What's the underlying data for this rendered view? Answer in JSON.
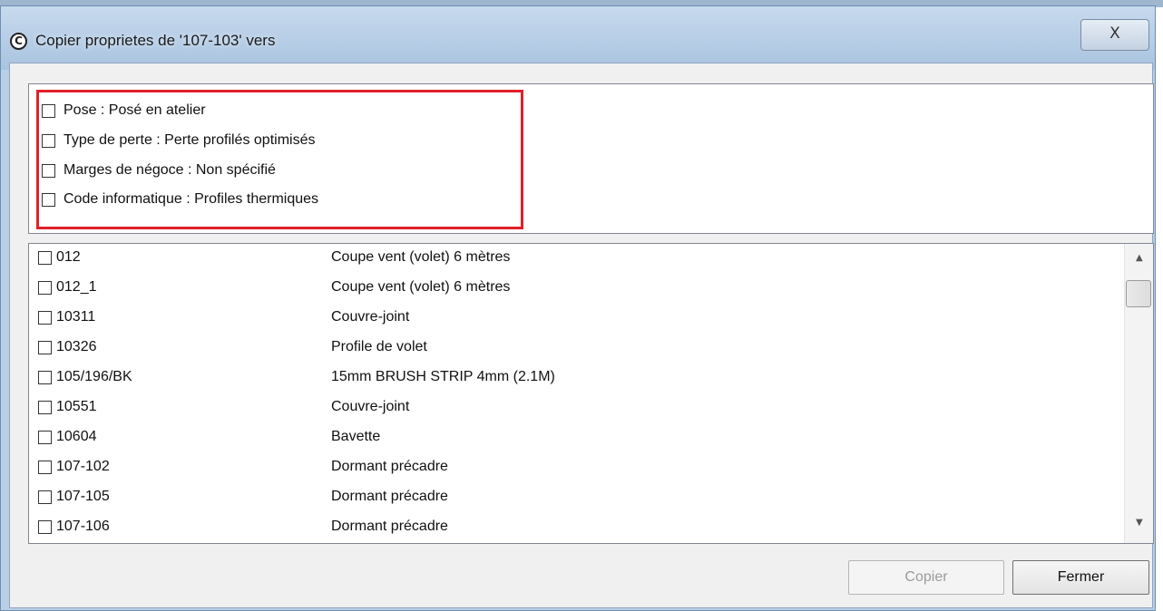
{
  "window": {
    "title": "Copier proprietes de '107-103' vers",
    "icon": "c-logo-icon",
    "close_glyph": "X"
  },
  "properties": [
    {
      "label": "Pose : Posé en atelier",
      "checked": false
    },
    {
      "label": "Type de perte : Perte profilés optimisés",
      "checked": false
    },
    {
      "label": "Marges de négoce : Non spécifié",
      "checked": false
    },
    {
      "label": "Code informatique : Profiles thermiques",
      "checked": false
    }
  ],
  "items": [
    {
      "code": "012",
      "description": "Coupe vent (volet) 6 mètres"
    },
    {
      "code": "012_1",
      "description": "Coupe vent (volet) 6 mètres"
    },
    {
      "code": "10311",
      "description": "Couvre-joint"
    },
    {
      "code": "10326",
      "description": "Profile de volet"
    },
    {
      "code": "105/196/BK",
      "description": "15mm BRUSH STRIP 4mm (2.1M)"
    },
    {
      "code": "10551",
      "description": "Couvre-joint"
    },
    {
      "code": "10604",
      "description": "Bavette"
    },
    {
      "code": "107-102",
      "description": "Dormant précadre"
    },
    {
      "code": "107-105",
      "description": "Dormant précadre"
    },
    {
      "code": "107-106",
      "description": "Dormant précadre"
    }
  ],
  "scroll": {
    "up_glyph": "▲",
    "down_glyph": "▼"
  },
  "buttons": {
    "copy": "Copier",
    "close": "Fermer"
  },
  "colors": {
    "highlight": "#e0202a",
    "titlebar": "#b8cfe6"
  }
}
